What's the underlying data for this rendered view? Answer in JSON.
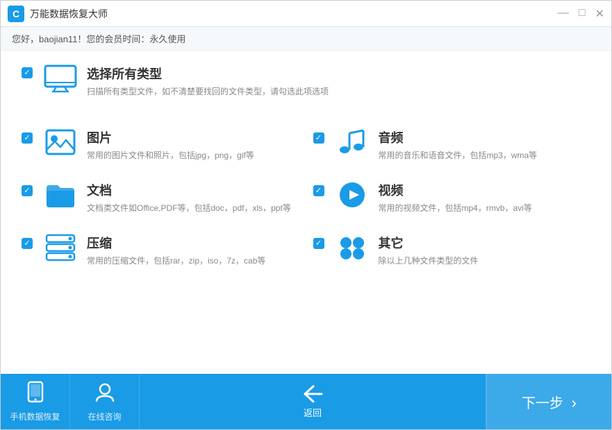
{
  "titlebar": {
    "logo_text": "C",
    "title": "万能数据恢复大师",
    "controls": {
      "minimize": "—",
      "maximize": "□",
      "close": "✕"
    }
  },
  "userbar": {
    "greeting": "您好，baojian11！您的会员时间：永久使用"
  },
  "select_all": {
    "label": "选择所有类型",
    "description": "扫描所有类型文件，如不清楚要找回的文件类型，请勾选此项选项"
  },
  "options": [
    {
      "id": "image",
      "label": "图片",
      "description": "常用的图片文件和照片，包括jpg，png，gif等",
      "checked": true,
      "col": 0
    },
    {
      "id": "audio",
      "label": "音频",
      "description": "常用的音乐和语音文件，包括mp3，wma等",
      "checked": true,
      "col": 1
    },
    {
      "id": "document",
      "label": "文档",
      "description": "文档类文件如Office,PDF等，包括doc，pdf，xls，ppt等",
      "checked": true,
      "col": 0
    },
    {
      "id": "video",
      "label": "视频",
      "description": "常用的视频文件，包括mp4，rmvb，avi等",
      "checked": true,
      "col": 1
    },
    {
      "id": "compress",
      "label": "压缩",
      "description": "常用的压缩文件，包括rar，zip，iso，7z，cab等",
      "checked": true,
      "col": 0
    },
    {
      "id": "other",
      "label": "其它",
      "description": "除以上几种文件类型的文件",
      "checked": true,
      "col": 1
    }
  ],
  "footer": {
    "phone_recovery_label": "手机数据恢复",
    "online_consult_label": "在线咨询",
    "back_label": "返回",
    "next_label": "下一步",
    "next_arrow": "›"
  }
}
